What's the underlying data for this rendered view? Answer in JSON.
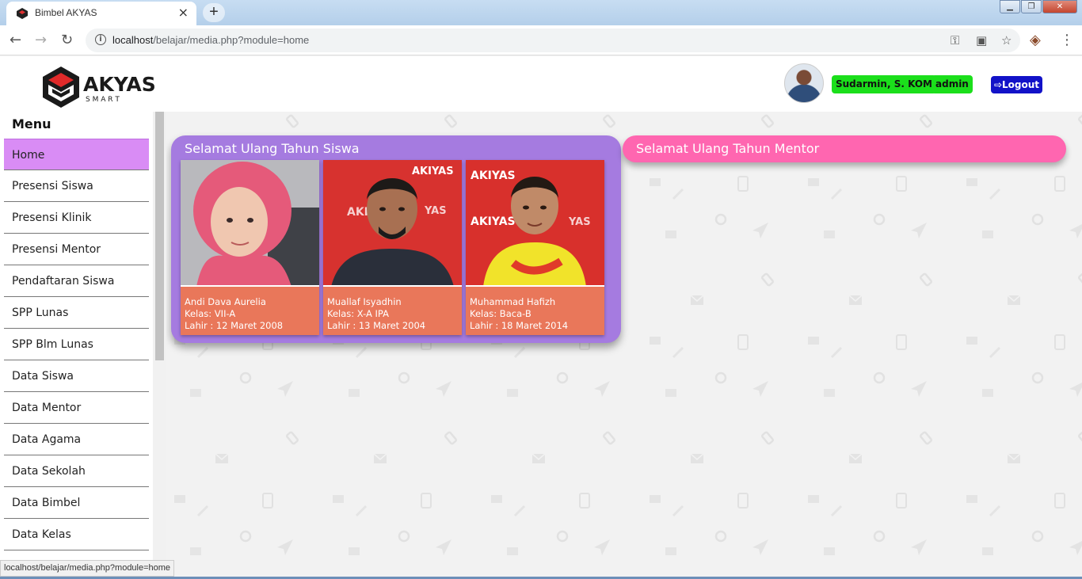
{
  "browser": {
    "tab_title": "Bimbel AKYAS",
    "tab_close": "×",
    "new_tab": "+",
    "url_host": "localhost",
    "url_path": "/belajar/media.php?module=home",
    "status_url": "localhost/belajar/media.php?module=home"
  },
  "header": {
    "logo_word": "AKYAS",
    "logo_sub": "S M A R T",
    "user_name": "Sudarmin, S. KOM",
    "user_role": "admin",
    "logout_label": "Logout"
  },
  "sidebar": {
    "title": "Menu",
    "items": [
      {
        "label": "Home",
        "active": true
      },
      {
        "label": "Presensi Siswa"
      },
      {
        "label": "Presensi Klinik"
      },
      {
        "label": "Presensi Mentor"
      },
      {
        "label": "Pendaftaran Siswa"
      },
      {
        "label": "SPP Lunas"
      },
      {
        "label": "SPP Blm Lunas"
      },
      {
        "label": "Data Siswa"
      },
      {
        "label": "Data Mentor"
      },
      {
        "label": "Data Agama"
      },
      {
        "label": "Data Sekolah"
      },
      {
        "label": "Data Bimbel"
      },
      {
        "label": "Data Kelas"
      }
    ]
  },
  "birthday_students": {
    "title": "Selamat Ulang Tahun Siswa",
    "cards": [
      {
        "name": "Andi Dava Aurelia",
        "kelas": "Kelas: VII-A",
        "lahir": "Lahir : 12 Maret 2008"
      },
      {
        "name": "Muallaf Isyadhin",
        "kelas": "Kelas: X-A IPA",
        "lahir": "Lahir : 13 Maret 2004"
      },
      {
        "name": "Muhammad Hafizh",
        "kelas": "Kelas: Baca-B",
        "lahir": "Lahir : 18 Maret 2014"
      }
    ]
  },
  "birthday_mentors": {
    "title": "Selamat Ulang Tahun Mentor"
  },
  "colors": {
    "active_menu": "#d98cf5",
    "student_panel": "#a57be0",
    "mentor_panel": "#ff66b0",
    "card": "#e9775a",
    "badge_green": "#1bdf1b",
    "logout_blue": "#1212c8"
  }
}
